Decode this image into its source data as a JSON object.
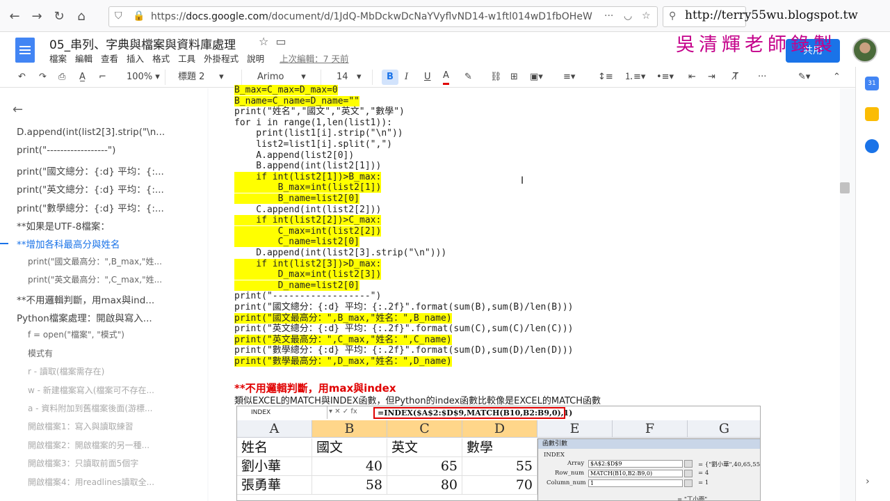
{
  "browser": {
    "url_prefix": "https://",
    "url_domain": "docs.google.com",
    "url_rest": "/document/d/1JdQ-MbDckwDcNaYVyflvND14-w1ftl014wD1fbOHeW"
  },
  "watermark": {
    "url": "http://terry55wu.blogspot.tw",
    "name": "吳清輝老師錄製"
  },
  "doc": {
    "title": "05_串列、字典與檔案與資料庫處理",
    "menus": [
      "檔案",
      "編輯",
      "查看",
      "插入",
      "格式",
      "工具",
      "外掛程式",
      "說明"
    ],
    "last_edit": "上次編輯：7 天前",
    "share_label": "共用"
  },
  "toolbar": {
    "zoom": "100%",
    "style": "標題 2",
    "font": "Arimo",
    "size": "14"
  },
  "outline": [
    {
      "text": "D.append(int(list2[3].strip(\"\\n...",
      "level": "h2"
    },
    {
      "text": "print(\"------------------\")",
      "level": "h2"
    },
    {
      "text": "print(\"國文總分：{:d} 平均：{:...",
      "level": "h2"
    },
    {
      "text": "print(\"英文總分：{:d} 平均：{:...",
      "level": "h2"
    },
    {
      "text": "print(\"數學總分：{:d} 平均：{:...",
      "level": "h2"
    },
    {
      "text": "**如果是UTF-8檔案：",
      "level": "h2"
    },
    {
      "text": "**增加各科最高分與姓名",
      "level": "h2"
    },
    {
      "text": "print(\"國文最高分：\",B_max,\"姓...",
      "level": "h3"
    },
    {
      "text": "print(\"英文最高分：\",C_max,\"姓...",
      "level": "h3"
    },
    {
      "text": "**不用邏輯判斷，用max與ind...",
      "level": "h2"
    },
    {
      "text": "Python檔案處理：開啟與寫入...",
      "level": "h2"
    },
    {
      "text": "f = open(\"檔案\", \"模式\")",
      "level": "h3"
    },
    {
      "text": "模式有",
      "level": "h3"
    },
    {
      "text": "r - 讀取(檔案需存在)",
      "level": "h3"
    },
    {
      "text": "w - 新建檔案寫入(檔案可不存在...",
      "level": "h3"
    },
    {
      "text": "a - 資料附加到舊檔案後面(游標...",
      "level": "h3"
    },
    {
      "text": "開啟檔案1：寫入與讀取練習",
      "level": "h3"
    },
    {
      "text": "開啟檔案2：開啟檔案的另一種...",
      "level": "h3"
    },
    {
      "text": "開啟檔案3：只讀取前面5個字",
      "level": "h3"
    },
    {
      "text": "開啟檔案4：用readlines讀取全...",
      "level": "h3"
    }
  ],
  "code_lines": [
    {
      "text": "B_max=C_max=D_max=0",
      "hl": true
    },
    {
      "text": "B_name=C_name=D_name=\"\"",
      "hl": true
    },
    {
      "text": "print(\"姓名\",\"國文\",\"英文\",\"數學\")",
      "hl": false
    },
    {
      "text": "for i in range(1,len(list1)):",
      "hl": false
    },
    {
      "text": "    print(list1[i].strip(\"\\n\"))",
      "hl": false
    },
    {
      "text": "    list2=list1[i].split(\",\")",
      "hl": false
    },
    {
      "text": "    A.append(list2[0])",
      "hl": false
    },
    {
      "text": "    B.append(int(list2[1]))",
      "hl": false
    },
    {
      "text": "    if int(list2[1])>B_max:",
      "hl": true
    },
    {
      "text": "        B_max=int(list2[1])",
      "hl": true
    },
    {
      "text": "        B_name=list2[0]",
      "hl": true
    },
    {
      "text": "    C.append(int(list2[2]))",
      "hl": false
    },
    {
      "text": "    if int(list2[2])>C_max:",
      "hl": true
    },
    {
      "text": "        C_max=int(list2[2])",
      "hl": true
    },
    {
      "text": "        C_name=list2[0]",
      "hl": true
    },
    {
      "text": "    D.append(int(list2[3].strip(\"\\n\")))",
      "hl": false
    },
    {
      "text": "    if int(list2[3])>D_max:",
      "hl": true
    },
    {
      "text": "        D_max=int(list2[3])",
      "hl": true
    },
    {
      "text": "        D_name=list2[0]",
      "hl": true
    },
    {
      "text": "print(\"------------------\")",
      "hl": false
    },
    {
      "text": "print(\"國文總分：{:d} 平均：{:.2f}\".format(sum(B),sum(B)/len(B)))",
      "hl": false
    },
    {
      "text": "print(\"國文最高分：\",B_max,\"姓名：\",B_name)",
      "hl": true
    },
    {
      "text": "print(\"英文總分：{:d} 平均：{:.2f}\".format(sum(C),sum(C)/len(C)))",
      "hl": false
    },
    {
      "text": "print(\"英文最高分：\",C_max,\"姓名：\",C_name)",
      "hl": true
    },
    {
      "text": "print(\"數學總分：{:d} 平均：{:.2f}\".format(sum(D),sum(D)/len(D)))",
      "hl": false
    },
    {
      "text": "print(\"數學最高分：\",D_max,\"姓名：\",D_name)",
      "hl": true
    }
  ],
  "section": {
    "heading": "**不用邏輯判斷，用max與index",
    "desc": "類似EXCEL的MATCH與INDEX函數，但Python的index函數比較像是EXCEL的MATCH函數"
  },
  "excel": {
    "namebox": "INDEX",
    "formula": "=INDEX($A$2:$D$9,MATCH(B10,B2:B9,0),1)",
    "columns": [
      "A",
      "B",
      "C",
      "D",
      "E",
      "F",
      "G"
    ],
    "rows": [
      [
        "姓名",
        "國文",
        "英文",
        "數學"
      ],
      [
        "劉小華",
        "40",
        "65",
        "55"
      ],
      [
        "張勇華",
        "58",
        "80",
        "70"
      ]
    ],
    "dialog": {
      "title": "函數引數",
      "func": "INDEX",
      "args": [
        {
          "name": "Array",
          "value": "$A$2:$D$9",
          "result": "= {\"劉小華\",40,65,55;"
        },
        {
          "name": "Row_num",
          "value": "MATCH(B10,B2:B9,0)",
          "result": "= 4"
        },
        {
          "name": "Column_num",
          "value": "1",
          "result": "= 1"
        }
      ],
      "result_line": "= \"丁小雨\""
    }
  }
}
